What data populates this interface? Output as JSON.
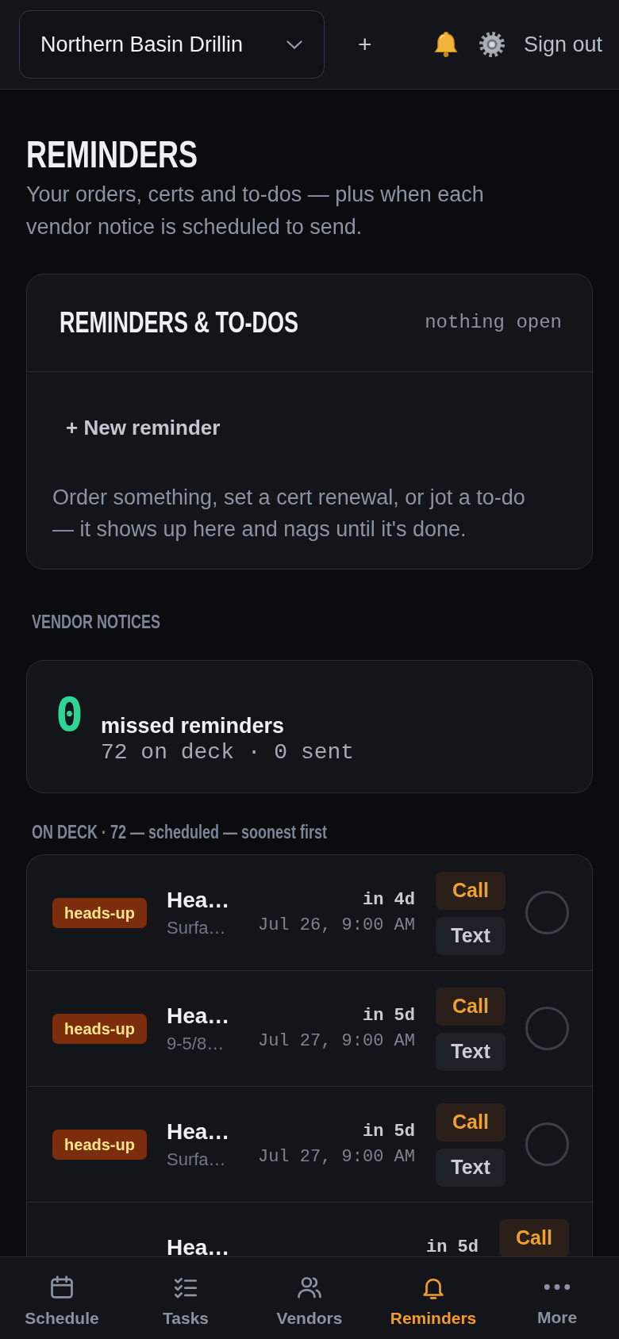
{
  "top_bar": {
    "workspace_select": {
      "value": "Northern Basin Drillin"
    },
    "add_button": "+",
    "sign_out": "Sign out"
  },
  "header": {
    "title": "REMINDERS",
    "subtitle": "Your orders, certs and to-dos — plus when each vendor notice is scheduled to send."
  },
  "reminders_card": {
    "title": "REMINDERS & TO-DOS",
    "status": "nothing open",
    "new_button": "+ New reminder",
    "empty_text": "Order something, set a cert renewal, or jot a to-do — it shows up here and nags until it's done."
  },
  "vendor_notices": {
    "heading": "VENDOR NOTICES",
    "missed_count": "0",
    "missed_label": "missed reminders",
    "summary": "72 on deck · 0 sent"
  },
  "on_deck": {
    "heading": "ON DECK · 72 — scheduled — soonest first",
    "rows": [
      {
        "badge": "heads-up",
        "title": "Hea…",
        "detail": "Surfa…",
        "when": "in 4d",
        "date": "Jul 26, 9:00 AM",
        "actions": [
          {
            "label": "Call",
            "kind": "call"
          },
          {
            "label": "Text",
            "kind": "text"
          }
        ],
        "checked": false
      },
      {
        "badge": "heads-up",
        "title": "Hea…",
        "detail": "9-5/8…",
        "when": "in 5d",
        "date": "Jul 27, 9:00 AM",
        "actions": [
          {
            "label": "Call",
            "kind": "call"
          },
          {
            "label": "Text",
            "kind": "text"
          }
        ],
        "checked": false
      },
      {
        "badge": "heads-up",
        "title": "Hea…",
        "detail": "Surfa…",
        "when": "in 5d",
        "date": "Jul 27, 9:00 AM",
        "actions": [
          {
            "label": "Call",
            "kind": "call"
          },
          {
            "label": "Text",
            "kind": "text"
          }
        ],
        "checked": false
      },
      {
        "title": "Hea…",
        "when": "in 5d",
        "actions": [
          {
            "label": "Call",
            "kind": "call"
          }
        ]
      }
    ]
  },
  "bottom_nav": [
    {
      "label": "Schedule",
      "selected": false
    },
    {
      "label": "Tasks",
      "selected": false
    },
    {
      "label": "Vendors",
      "selected": false
    },
    {
      "label": "Reminders",
      "selected": true
    },
    {
      "label": "More",
      "selected": false
    }
  ]
}
